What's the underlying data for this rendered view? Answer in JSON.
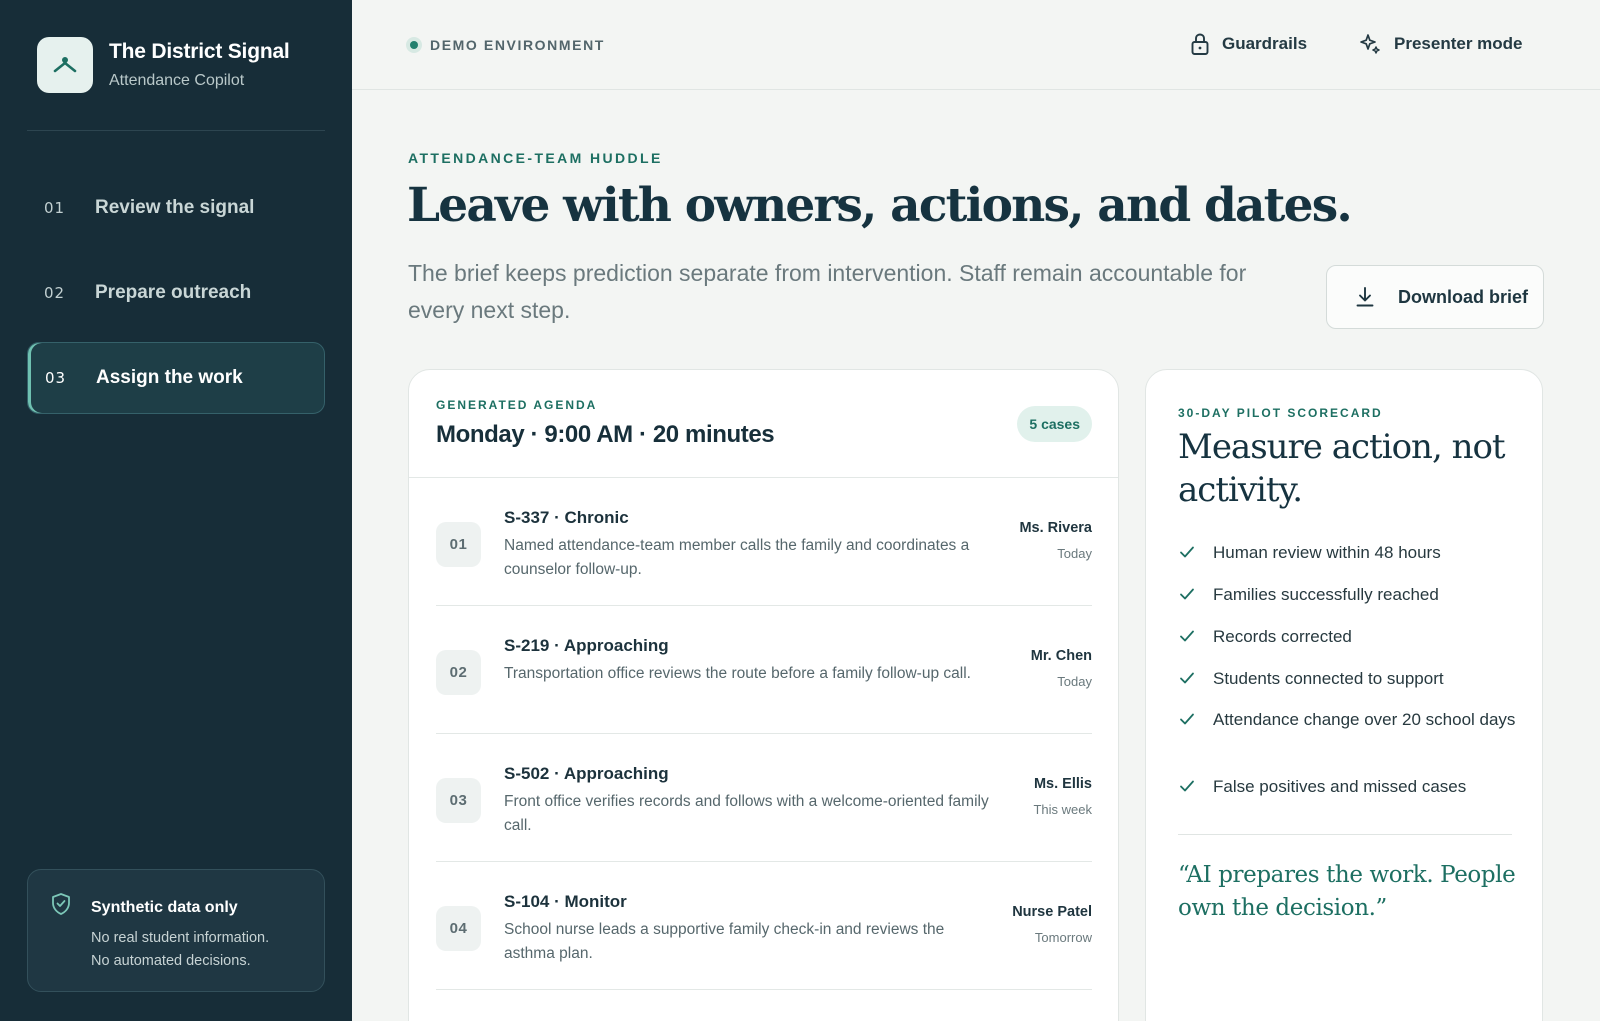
{
  "brand": {
    "title": "The District Signal",
    "subtitle": "Attendance Copilot",
    "logo_icon": "person-arms-icon"
  },
  "nav": {
    "items": [
      {
        "num": "01",
        "label": "Review the signal",
        "active": false
      },
      {
        "num": "02",
        "label": "Prepare outreach",
        "active": false
      },
      {
        "num": "03",
        "label": "Assign the work",
        "active": true
      }
    ]
  },
  "notice": {
    "icon": "shield-check-icon",
    "title": "Synthetic data only",
    "line1": "No real student information.",
    "line2": "No automated decisions."
  },
  "topbar": {
    "environment": "DEMO ENVIRONMENT",
    "guardrails_label": "Guardrails",
    "guardrails_icon": "lock-icon",
    "presenter_label": "Presenter mode",
    "presenter_icon": "sparkle-icon"
  },
  "hero": {
    "eyebrow": "ATTENDANCE-TEAM HUDDLE",
    "headline": "Leave with owners, actions, and dates.",
    "lead": "The brief keeps prediction separate from intervention. Staff remain accountable for every next step.",
    "download_label": "Download brief",
    "download_icon": "download-icon"
  },
  "agenda": {
    "eyebrow": "GENERATED AGENDA",
    "title": "Monday · 9:00 AM · 20 minutes",
    "badge": "5 cases",
    "rows": [
      {
        "num": "01",
        "title": "S-337 · Chronic",
        "desc": "Named attendance-team member calls the family and coordinates a counselor follow-up.",
        "owner": "Ms. Rivera",
        "when": "Today"
      },
      {
        "num": "02",
        "title": "S-219 · Approaching",
        "desc": "Transportation office reviews the route before a family follow-up call.",
        "owner": "Mr. Chen",
        "when": "Today"
      },
      {
        "num": "03",
        "title": "S-502 · Approaching",
        "desc": "Front office verifies records and follows with a welcome-oriented family call.",
        "owner": "Ms. Ellis",
        "when": "This week"
      },
      {
        "num": "04",
        "title": "S-104 · Monitor",
        "desc": "School nurse leads a supportive family check-in and reviews the asthma plan.",
        "owner": "Nurse Patel",
        "when": "Tomorrow"
      }
    ]
  },
  "scorecard": {
    "eyebrow": "30-DAY PILOT SCORECARD",
    "title": "Measure action, not activity.",
    "items": [
      "Human review within 48 hours",
      "Families successfully reached",
      "Records corrected",
      "Students connected to support",
      "Attendance change over 20 school days",
      "False positives and missed cases"
    ],
    "quote": "“AI prepares the work. People own the decision.”"
  },
  "colors": {
    "sidebar": "#172d38",
    "accent": "#1d6f62",
    "background": "#f3f5f3"
  }
}
